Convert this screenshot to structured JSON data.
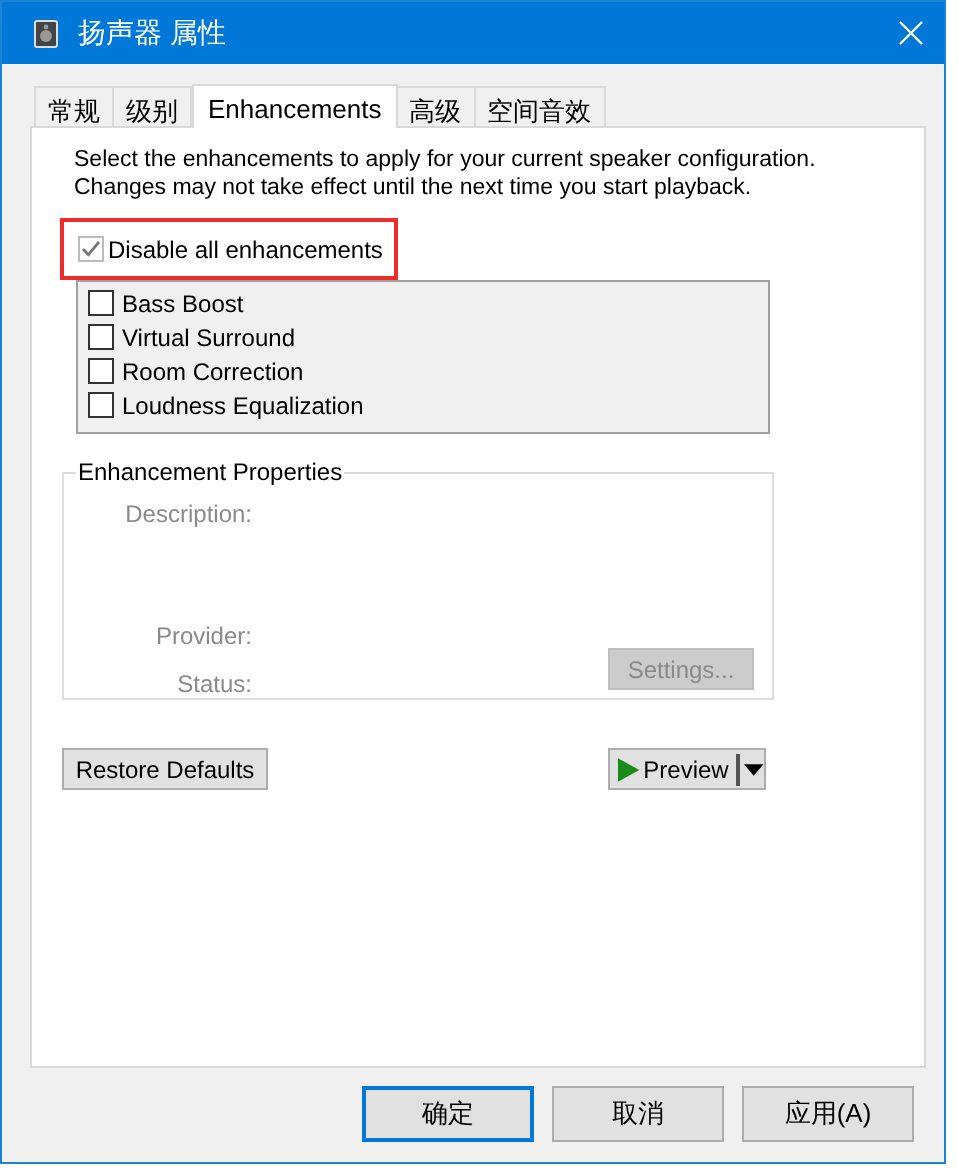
{
  "window": {
    "title": "扬声器 属性"
  },
  "tabs": [
    {
      "label": "常规",
      "selected": false
    },
    {
      "label": "级别",
      "selected": false
    },
    {
      "label": "Enhancements",
      "selected": true
    },
    {
      "label": "高级",
      "selected": false
    },
    {
      "label": "空间音效",
      "selected": false
    }
  ],
  "description": "Select the enhancements to apply for your current speaker configuration. Changes may not take effect until the next time you start playback.",
  "disable_all": {
    "label": "Disable all enhancements",
    "checked": true
  },
  "enhancements": [
    {
      "label": "Bass Boost",
      "checked": false
    },
    {
      "label": "Virtual Surround",
      "checked": false
    },
    {
      "label": "Room Correction",
      "checked": false
    },
    {
      "label": "Loudness Equalization",
      "checked": false
    }
  ],
  "properties": {
    "title": "Enhancement Properties",
    "description_label": "Description:",
    "provider_label": "Provider:",
    "status_label": "Status:",
    "settings_button": {
      "label": "Settings...",
      "disabled": true
    }
  },
  "restore_button": "Restore Defaults",
  "preview_button": "Preview",
  "buttons": [
    {
      "label": "确定",
      "default": true
    },
    {
      "label": "取消",
      "default": false
    },
    {
      "label": "应用(A)",
      "default": false
    }
  ]
}
